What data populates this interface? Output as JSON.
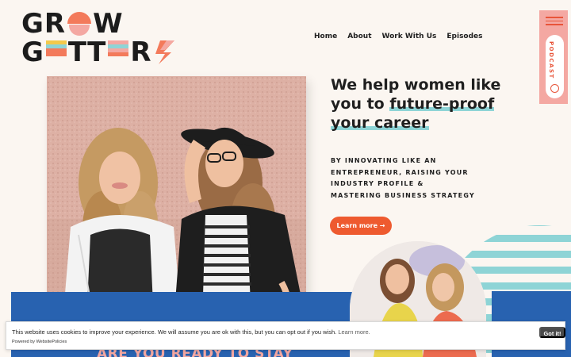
{
  "logo": {
    "row1": [
      "G",
      "R",
      "O",
      "W"
    ],
    "row2": [
      "G",
      "E",
      "T",
      "T",
      "E",
      "R",
      "S"
    ],
    "colors": {
      "orange": "#f37a5b",
      "pink": "#f4a8a2",
      "teal": "#8ed4d6",
      "yellow": "#f2c94c",
      "dark": "#1c1c1c"
    }
  },
  "nav": {
    "items": [
      {
        "label": "Home"
      },
      {
        "label": "About"
      },
      {
        "label": "Work With Us"
      },
      {
        "label": "Episodes"
      }
    ]
  },
  "sidetab": {
    "menu_icon": "hamburger-icon",
    "label": "PODCAST",
    "icon": "podcast-icon"
  },
  "hero": {
    "headline_line1": "We help women like",
    "headline_you_to": "you to ",
    "headline_highlight1": "future-proof",
    "headline_highlight2": "your career",
    "sub_lines": [
      "BY INNOVATING LIKE AN",
      "ENTREPRENEUR, RAISING YOUR",
      "INDUSTRY PROFILE &",
      "MASTERING BUSINESS STRATEGY"
    ],
    "button_label": "Learn more →"
  },
  "cta_heading": "ARE YOU READY TO STAY",
  "cookie": {
    "message": "This website uses cookies to improve your experience. We will assume you are ok with this, but you can opt out if you wish.",
    "learn_more": "Learn more.",
    "powered_by": "Powered by WebsitePolicies",
    "button_label": "Got it!"
  },
  "colors": {
    "accent": "#ee5a2f",
    "teal": "#8ed4d6",
    "blue": "#2862b0",
    "pink": "#f4a8a2",
    "background": "#fbf6f1"
  }
}
